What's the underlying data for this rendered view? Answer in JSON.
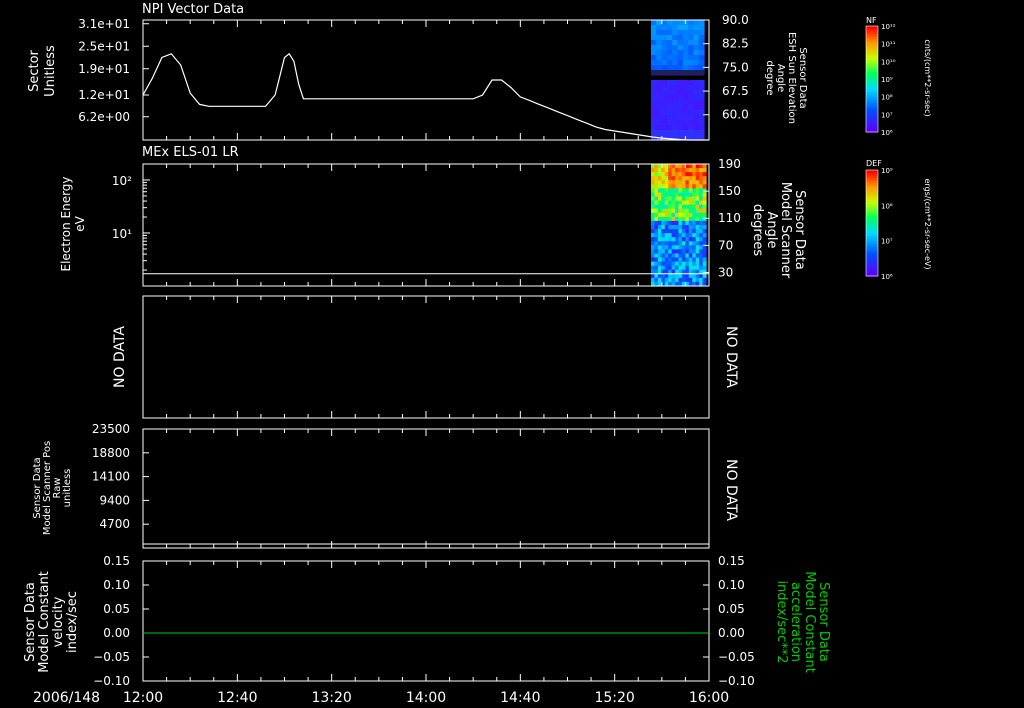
{
  "chart_data": [
    {
      "type": "line",
      "title": "NPI Vector Data",
      "ylabel": [
        "Sector",
        "Unitless"
      ],
      "yticks": [
        "3.1e+01",
        "2.5e+01",
        "1.9e+01",
        "1.2e+01",
        "6.2e+00"
      ],
      "ytick_values": [
        31,
        25,
        19,
        12,
        6.2
      ],
      "ylim": [
        0,
        32
      ],
      "ylabel_right": [
        "Sensor Data",
        "ESH Sun Elevation",
        "Angle",
        "degree"
      ],
      "yticks_right": [
        "90.0",
        "82.5",
        "75.0",
        "67.5",
        "60.0"
      ],
      "ylim_right": [
        52,
        90
      ],
      "series": [
        {
          "x": [
            0,
            4,
            8,
            12,
            16,
            20,
            24,
            28,
            32,
            36,
            40,
            44,
            48,
            52,
            56,
            58,
            60,
            62,
            64,
            66,
            68,
            72,
            76,
            80,
            84,
            88,
            92,
            96,
            100,
            104,
            108,
            112,
            116,
            120,
            124,
            128,
            132,
            136,
            140,
            144,
            148,
            152,
            156,
            160,
            164,
            168,
            172,
            176,
            180,
            184,
            188,
            192,
            196,
            200,
            204,
            208,
            212,
            216,
            220,
            224,
            228,
            232,
            236,
            240
          ],
          "y": [
            12,
            16.5,
            22,
            23,
            20,
            12.5,
            9.5,
            9,
            9,
            9,
            9,
            9,
            9,
            9,
            12,
            17,
            22,
            23,
            21,
            15,
            11,
            11,
            11,
            11,
            11,
            11,
            11,
            11,
            11,
            11,
            11,
            11,
            11,
            11,
            11,
            11,
            11,
            11,
            11,
            12,
            16,
            16,
            14,
            11.5,
            10.5,
            9.5,
            8.5,
            7.5,
            6.5,
            5.5,
            4.5,
            3.5,
            2.8,
            2.4,
            2,
            1.6,
            1.2,
            0.8,
            0.5,
            0.3,
            0.1,
            0,
            0,
            0
          ]
        }
      ],
      "spectrogram": {
        "title": "NF",
        "colorbar_ticks": [
          "10¹²",
          "10¹¹",
          "10¹⁰",
          "10⁹",
          "10⁸",
          "10⁷",
          "10⁶"
        ],
        "colorbar_label": "cnts/(cm**2-sr-sec)"
      }
    },
    {
      "type": "heatmap",
      "title": "MEx ELS-01 LR",
      "ylabel": [
        "Electron Energy",
        "eV"
      ],
      "yscale": "log",
      "yticks": [
        "10²",
        "10¹"
      ],
      "ylim": [
        1,
        200
      ],
      "series": [
        {
          "x": [
            0,
            240
          ],
          "y": [
            1.7,
            1.7
          ]
        }
      ],
      "ylabel_right": [
        "Sensor Data",
        "Model Scanner",
        "Angle",
        "degrees"
      ],
      "yticks_right": [
        "190",
        "150",
        "110",
        "70",
        "30"
      ],
      "ylim_right": [
        10,
        190
      ],
      "spectrogram": {
        "title": "DEF",
        "colorbar_ticks": [
          "10⁹",
          "10⁸",
          "10⁷",
          "10⁶"
        ],
        "colorbar_label": "ergs/(cm**2-sr-sec-eV)"
      }
    },
    {
      "type": "line",
      "ylabel": [
        "NO DATA"
      ],
      "ylabel_right": [
        "NO DATA"
      ]
    },
    {
      "type": "line",
      "ylabel": [
        "Sensor Data",
        "Model Scanner Pos",
        "Raw",
        "unitless"
      ],
      "yticks": [
        "23500",
        "18800",
        "14100",
        "9400",
        "4700"
      ],
      "ytick_values": [
        23500,
        18800,
        14100,
        9400,
        4700
      ],
      "ylim": [
        0,
        23500
      ],
      "series": [
        {
          "x": [
            0,
            240
          ],
          "y": [
            0,
            0
          ]
        }
      ],
      "ylabel_right": [
        "NO DATA"
      ]
    },
    {
      "type": "line",
      "ylabel": [
        "Sensor Data",
        "Model Constant",
        "velocity",
        "index/sec"
      ],
      "yticks": [
        "0.15",
        "0.10",
        "0.05",
        "0.00",
        "−0.05",
        "−0.10"
      ],
      "ytick_values": [
        0.15,
        0.1,
        0.05,
        0.0,
        -0.05,
        -0.1
      ],
      "ylim": [
        -0.1,
        0.15
      ],
      "series": [
        {
          "x": [
            0,
            240
          ],
          "y": [
            0,
            0
          ],
          "color": "#00cc00"
        }
      ],
      "ylabel_right": [
        "Sensor Data",
        "Model Constant",
        "acceleration",
        "index/sec**2"
      ],
      "yticks_right": [
        "0.15",
        "0.10",
        "0.05",
        "0.00",
        "−0.05",
        "−0.10"
      ]
    }
  ],
  "xaxis": {
    "date": "2006/148",
    "ticks": [
      "12:00",
      "12:40",
      "13:20",
      "14:00",
      "14:40",
      "15:20",
      "16:00"
    ],
    "range": [
      "12:00",
      "16:00"
    ]
  },
  "colors": {
    "background": "#000000",
    "axes": "#ffffff",
    "line": "#ffffff",
    "acceleration": "#00cc00"
  }
}
